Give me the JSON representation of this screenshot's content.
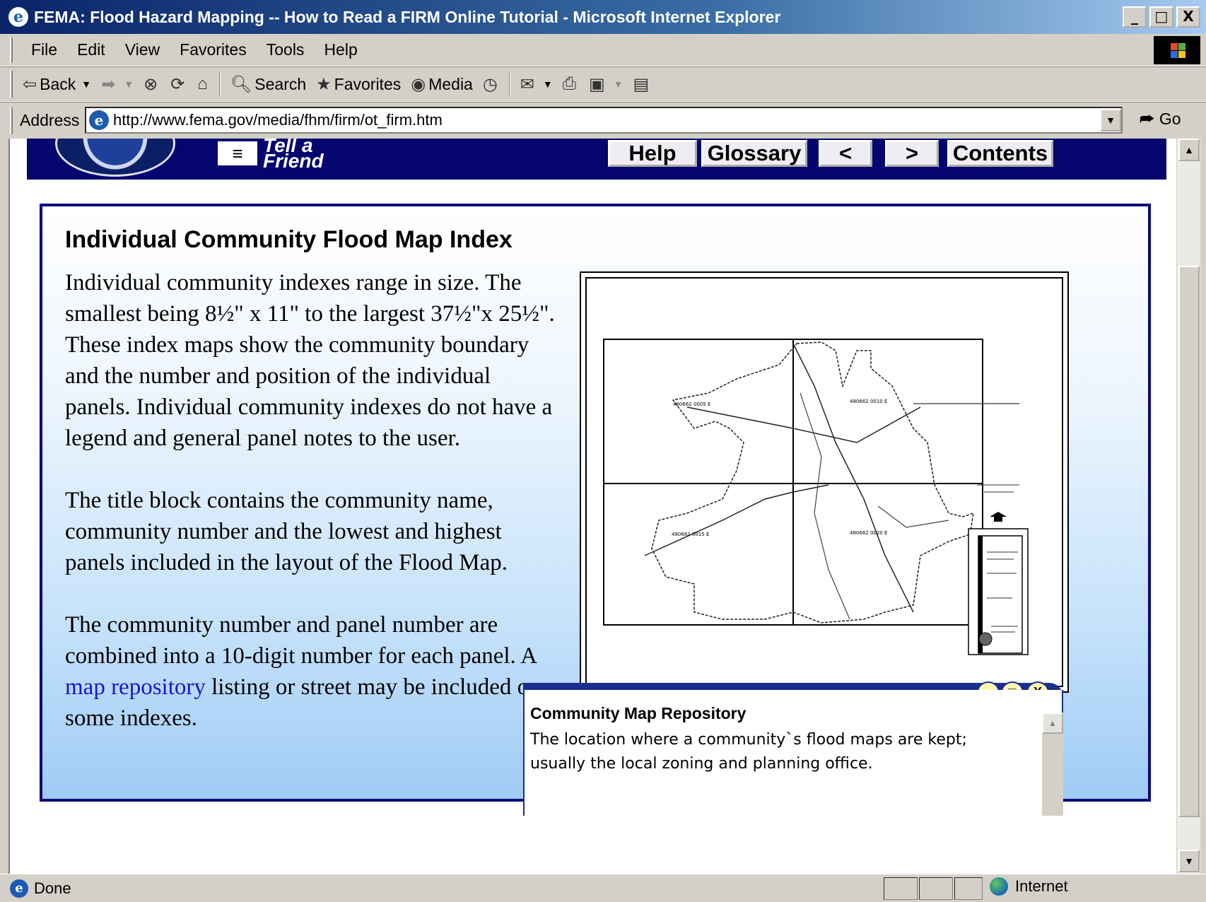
{
  "window": {
    "title": "FEMA: Flood Hazard Mapping -- How to Read a FIRM Online Tutorial - Microsoft Internet Explorer",
    "buttons": [
      "_",
      "□",
      "X"
    ]
  },
  "menu": [
    "File",
    "Edit",
    "View",
    "Favorites",
    "Tools",
    "Help"
  ],
  "toolbar": {
    "back": "Back",
    "search": "Search",
    "favorites": "Favorites",
    "media": "Media"
  },
  "address": {
    "label": "Address",
    "url": "http://www.fema.gov/media/fhm/firm/ot_firm.htm",
    "go": "Go"
  },
  "site": {
    "tell_friend_line1": "Tell a",
    "tell_friend_line2": "Friend",
    "nav": [
      "Help",
      "Glossary",
      "<",
      ">",
      "Contents"
    ]
  },
  "content": {
    "heading": "Individual Community Flood Map Index",
    "para1": "Individual community indexes range in size. The smallest being 8½\" x 11\" to the largest 37½\"x 25½\". These index maps show the community boundary and the number and position of the individual panels. Individual community indexes do not have a legend and general panel notes to the user.",
    "para2": "The title block contains the community name, community number and the lowest and highest panels included in the layout of the Flood Map.",
    "para3_before": "The community number and panel number are combined into a 10-digit number for each panel. A ",
    "para3_link": "map repository",
    "para3_after": " listing or street may be included on some indexes."
  },
  "popup": {
    "title": "Community Map Repository",
    "body": "The location where a community`s flood maps are kept; usually the local zoning and planning office."
  },
  "status": {
    "text": "Done",
    "zone": "Internet"
  },
  "icons": [
    "ie-icon",
    "back-arrow-icon",
    "forward-arrow-icon",
    "stop-icon",
    "refresh-icon",
    "home-icon",
    "search-icon",
    "favorites-icon",
    "media-icon",
    "history-icon",
    "mail-icon",
    "print-icon",
    "edit-icon",
    "discuss-icon",
    "go-arrow-icon",
    "globe-icon",
    "windows-logo-icon"
  ]
}
